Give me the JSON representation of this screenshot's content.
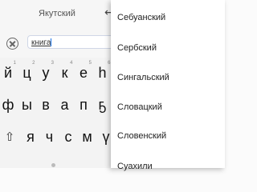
{
  "header": {
    "title": "Якутский",
    "back_icon": "back-arrow-icon"
  },
  "search": {
    "value": "книга",
    "clear_icon": "clear-circle-x-icon"
  },
  "keyboard": {
    "row1": [
      {
        "k": "й",
        "h": "1"
      },
      {
        "k": "ц",
        "h": "2"
      },
      {
        "k": "у",
        "h": "3"
      },
      {
        "k": "к",
        "h": "4"
      },
      {
        "k": "е",
        "h": "5"
      },
      {
        "k": "һ",
        "h": "6"
      }
    ],
    "row2": [
      {
        "k": "ф"
      },
      {
        "k": "ы"
      },
      {
        "k": "в"
      },
      {
        "k": "а"
      },
      {
        "k": "п"
      },
      {
        "k": "ҕ"
      }
    ],
    "row3": [
      {
        "k": "я"
      },
      {
        "k": "ч"
      },
      {
        "k": "с"
      },
      {
        "k": "м"
      },
      {
        "k": "ү"
      }
    ],
    "shift_icon": "shift-icon"
  },
  "menu": {
    "items": [
      "Себуанский",
      "Сербский",
      "Сингальский",
      "Словацкий",
      "Словенский",
      "Суахили"
    ]
  }
}
